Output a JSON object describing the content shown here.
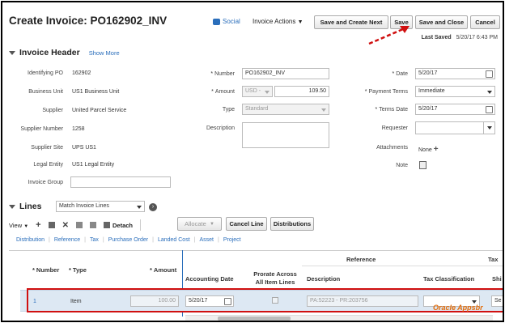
{
  "header": {
    "title": "Create Invoice: PO162902_INV",
    "social": "Social",
    "invoice_actions": "Invoice Actions",
    "buttons": {
      "save_create_next": "Save and Create Next",
      "save": "Save",
      "save_close": "Save and Close",
      "cancel": "Cancel"
    },
    "last_saved_label": "Last Saved",
    "last_saved_value": "5/20/17 6:43 PM"
  },
  "invoice_header": {
    "title": "Invoice Header",
    "show_more": "Show More",
    "left": [
      {
        "label": "Identifying PO",
        "value": "162902"
      },
      {
        "label": "Business Unit",
        "value": "US1 Business Unit"
      },
      {
        "label": "Supplier",
        "value": "United Parcel Service"
      },
      {
        "label": "Supplier Number",
        "value": "1258"
      },
      {
        "label": "Supplier Site",
        "value": "UPS US1"
      },
      {
        "label": "Legal Entity",
        "value": "US1 Legal Entity"
      },
      {
        "label": "Invoice Group",
        "value": ""
      }
    ],
    "middle": {
      "number_label": "Number",
      "number_value": "PO162902_INV",
      "amount_label": "Amount",
      "currency": "USD -",
      "amount_value": "109.50",
      "type_label": "Type",
      "type_value": "Standard",
      "description_label": "Description",
      "description_value": ""
    },
    "right": {
      "date_label": "Date",
      "date_value": "5/20/17",
      "payment_terms_label": "Payment Terms",
      "payment_terms_value": "Immediate",
      "terms_date_label": "Terms Date",
      "terms_date_value": "5/20/17",
      "requester_label": "Requester",
      "requester_value": "",
      "attachments_label": "Attachments",
      "attachments_value": "None",
      "note_label": "Note"
    }
  },
  "lines": {
    "title": "Lines",
    "match_select": "Match Invoice Lines",
    "toolbar": {
      "view": "View",
      "detach": "Detach",
      "allocate": "Allocate",
      "cancel_line": "Cancel Line",
      "distributions": "Distributions"
    },
    "tabs": [
      "Distribution",
      "Reference",
      "Tax",
      "Purchase Order",
      "Landed Cost",
      "Asset",
      "Project"
    ],
    "group_headers": {
      "reference": "Reference",
      "tax": "Tax"
    },
    "columns": {
      "number": "Number",
      "type": "Type",
      "amount": "Amount",
      "accounting_date": "Accounting Date",
      "prorate": "Prorate Across All Item Lines",
      "description": "Description",
      "tax_classification": "Tax Classification",
      "shi": "Shi"
    },
    "row": {
      "number": "1",
      "type": "Item",
      "amount": "100.00",
      "accounting_date": "5/20/17",
      "description": "PA:52223 - PR:203756",
      "shi": "Se"
    }
  },
  "watermark": {
    "brand": "Oracle Appsbr"
  },
  "colors": {
    "link": "#2a6ebb",
    "highlight": "#d01010",
    "row_bg": "#dde8f3"
  }
}
